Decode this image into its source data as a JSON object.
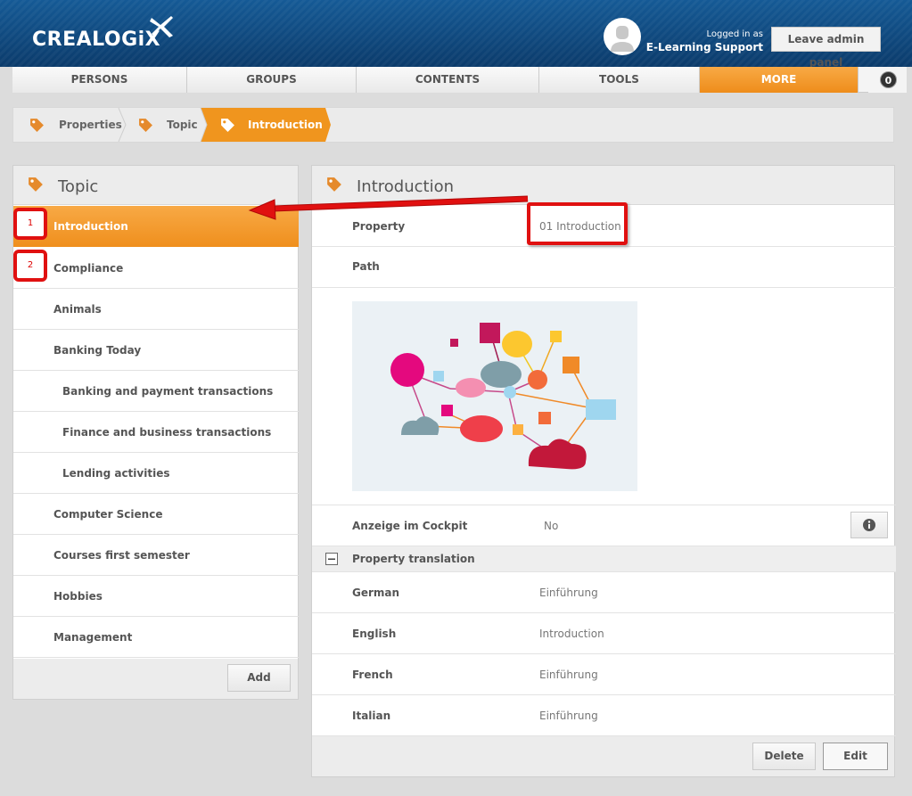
{
  "header": {
    "logo": "CREALOGiX",
    "login_label": "Logged in as",
    "login_name": "E-Learning Support",
    "leave_button": "Leave admin panel"
  },
  "nav": {
    "items": [
      {
        "label": "PERSONS"
      },
      {
        "label": "GROUPS"
      },
      {
        "label": "CONTENTS"
      },
      {
        "label": "TOOLS"
      },
      {
        "label": "MORE"
      }
    ],
    "count": "0"
  },
  "breadcrumb": [
    {
      "label": "Properties"
    },
    {
      "label": "Topic"
    },
    {
      "label": "Introduction"
    }
  ],
  "left_panel": {
    "title": "Topic",
    "items": [
      {
        "label": "Introduction"
      },
      {
        "label": "Compliance"
      },
      {
        "label": "Animals"
      },
      {
        "label": "Banking Today"
      },
      {
        "label": "Banking and payment transactions"
      },
      {
        "label": "Finance and business transactions"
      },
      {
        "label": "Lending activities"
      },
      {
        "label": "Computer Science"
      },
      {
        "label": "Courses first semester"
      },
      {
        "label": "Hobbies"
      },
      {
        "label": "Management"
      }
    ],
    "add_button": "Add"
  },
  "right_panel": {
    "title": "Introduction",
    "property_label": "Property",
    "property_value": "01 Introduction",
    "path_label": "Path",
    "cockpit_label": "Anzeige im Cockpit",
    "cockpit_value": "No",
    "translation_header": "Property translation",
    "translations": [
      {
        "language": "German",
        "value": "Einführung"
      },
      {
        "language": "English",
        "value": "Introduction"
      },
      {
        "language": "French",
        "value": "Einführung"
      },
      {
        "language": "Italian",
        "value": "Einführung"
      }
    ],
    "delete_button": "Delete",
    "edit_button": "Edit"
  },
  "annotations": {
    "marker_1": "1",
    "marker_2": "2"
  },
  "colors": {
    "accent": "#f0951e",
    "header_blue": "#0d4a82",
    "annotation_red": "#e01010"
  },
  "icons": {
    "tag": "tag-icon",
    "info": "info-icon",
    "collapse": "minus-box-icon",
    "user": "user-avatar-icon"
  }
}
